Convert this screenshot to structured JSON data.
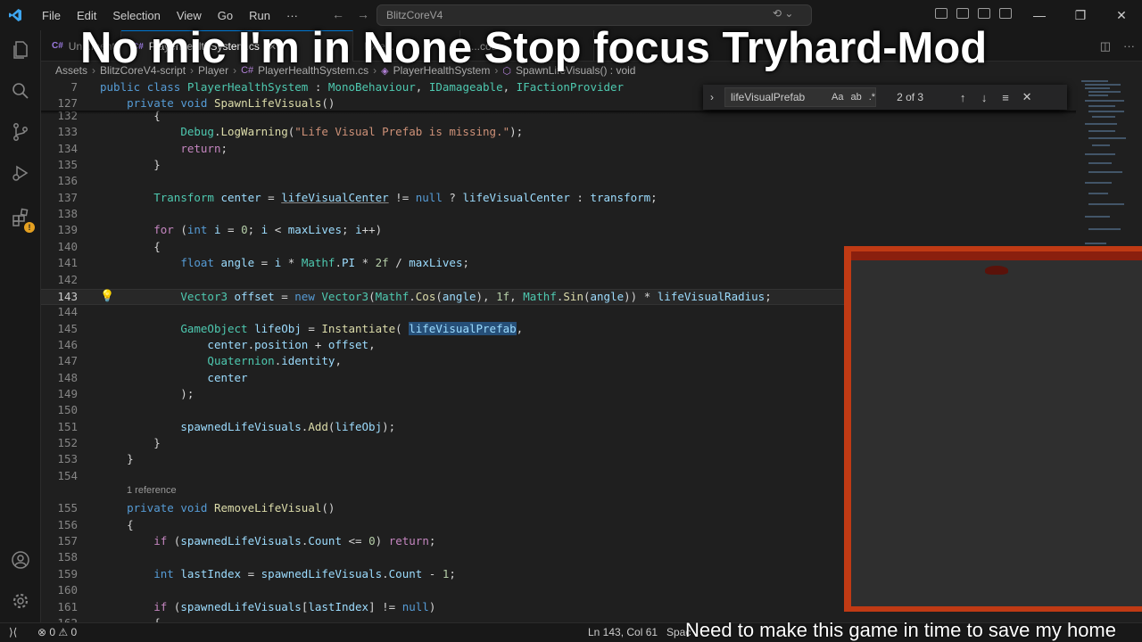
{
  "titlebar": {
    "menu": [
      "File",
      "Edit",
      "Selection",
      "View",
      "Go",
      "Run",
      "···"
    ],
    "command_center": "BlitzCoreV4"
  },
  "tabs": [
    {
      "label": "Un...ments.cs",
      "active": false
    },
    {
      "label": "PlayerHealthSystem.cs",
      "active": true
    },
    {
      "label": "Exte...",
      "active": false
    },
    {
      "label": "...code...",
      "active": false
    }
  ],
  "breadcrumb": [
    "Assets",
    "BlitzCoreV4-script",
    "Player",
    "PlayerHealthSystem.cs",
    "PlayerHealthSystem",
    "SpawnLifeVisuals() : void"
  ],
  "find": {
    "query": "lifeVisualPrefab",
    "match_case": "Aa",
    "whole_word": "ab",
    "regex": ".*",
    "count": "2 of 3"
  },
  "editor": {
    "sticky": [
      {
        "n": "7",
        "html": "<span class=\"k\">public</span> <span class=\"k\">class</span> <span class=\"t\">PlayerHealthSystem</span> : <span class=\"t\">MonoBehaviour</span>, <span class=\"t\">IDamageable</span>, <span class=\"t\">IFactionProvider</span>"
      },
      {
        "n": "127",
        "html": "    <span class=\"k\">private</span> <span class=\"k\">void</span> <span class=\"f\">SpawnLifeVisuals</span>()"
      }
    ],
    "lines": [
      {
        "n": "132",
        "html": "        {"
      },
      {
        "n": "133",
        "html": "            <span class=\"t\">Debug</span>.<span class=\"f\">LogWarning</span>(<span class=\"s\">\"Life Visual Prefab is missing.\"</span>);"
      },
      {
        "n": "134",
        "html": "            <span class=\"c\">return</span>;"
      },
      {
        "n": "135",
        "html": "        }"
      },
      {
        "n": "136",
        "html": ""
      },
      {
        "n": "137",
        "html": "        <span class=\"t\">Transform</span> <span class=\"v\">center</span> = <span class=\"v ul\">lifeVisualCenter</span> != <span class=\"k\">null</span> ? <span class=\"v\">lifeVisualCenter</span> : <span class=\"v\">transform</span>;"
      },
      {
        "n": "138",
        "html": ""
      },
      {
        "n": "139",
        "html": "        <span class=\"c\">for</span> (<span class=\"k\">int</span> <span class=\"v\">i</span> = <span class=\"n\">0</span>; <span class=\"v\">i</span> &lt; <span class=\"v\">maxLives</span>; <span class=\"v\">i</span>++)"
      },
      {
        "n": "140",
        "html": "        {"
      },
      {
        "n": "141",
        "html": "            <span class=\"k\">float</span> <span class=\"v\">angle</span> = <span class=\"v\">i</span> * <span class=\"t\">Mathf</span>.<span class=\"v\">PI</span> * <span class=\"n\">2f</span> / <span class=\"v\">maxLives</span>;"
      },
      {
        "n": "142",
        "html": ""
      },
      {
        "n": "143",
        "html": "            <span class=\"t\">Vector3</span> <span class=\"v\">offset</span> = <span class=\"k\">new</span> <span class=\"t\">Vector3</span>(<span class=\"t\">Mathf</span>.<span class=\"f\">Cos</span>(<span class=\"v\">angle</span>), <span class=\"n\">1f</span>, <span class=\"t\">Mathf</span>.<span class=\"f\">Sin</span>(<span class=\"v\">angle</span>)) * <span class=\"v\">lifeVisualRadius</span>;",
        "current": true
      },
      {
        "n": "144",
        "html": ""
      },
      {
        "n": "145",
        "html": "            <span class=\"t\">GameObject</span> <span class=\"v\">lifeObj</span> = <span class=\"f\">Instantiate</span>( <span class=\"v hl\">lifeVisualPrefab</span>,"
      },
      {
        "n": "146",
        "html": "                <span class=\"v\">center</span>.<span class=\"v\">position</span> + <span class=\"v\">offset</span>,"
      },
      {
        "n": "147",
        "html": "                <span class=\"t\">Quaternion</span>.<span class=\"v\">identity</span>,"
      },
      {
        "n": "148",
        "html": "                <span class=\"v\">center</span>"
      },
      {
        "n": "149",
        "html": "            );"
      },
      {
        "n": "150",
        "html": ""
      },
      {
        "n": "151",
        "html": "            <span class=\"v\">spawnedLifeVisuals</span>.<span class=\"f\">Add</span>(<span class=\"v\">lifeObj</span>);"
      },
      {
        "n": "152",
        "html": "        }"
      },
      {
        "n": "153",
        "html": "    }"
      },
      {
        "n": "154",
        "html": ""
      },
      {
        "lens": "1 reference"
      },
      {
        "n": "155",
        "html": "    <span class=\"k\">private</span> <span class=\"k\">void</span> <span class=\"f\">RemoveLifeVisual</span>()"
      },
      {
        "n": "156",
        "html": "    {"
      },
      {
        "n": "157",
        "html": "        <span class=\"c\">if</span> (<span class=\"v\">spawnedLifeVisuals</span>.<span class=\"v\">Count</span> &lt;= <span class=\"n\">0</span>) <span class=\"c\">return</span>;"
      },
      {
        "n": "158",
        "html": ""
      },
      {
        "n": "159",
        "html": "        <span class=\"k\">int</span> <span class=\"v\">lastIndex</span> = <span class=\"v\">spawnedLifeVisuals</span>.<span class=\"v\">Count</span> - <span class=\"n\">1</span>;"
      },
      {
        "n": "160",
        "html": ""
      },
      {
        "n": "161",
        "html": "        <span class=\"c\">if</span> (<span class=\"v\">spawnedLifeVisuals</span>[<span class=\"v\">lastIndex</span>] != <span class=\"k\">null</span>)"
      },
      {
        "n": "162",
        "html": "        {"
      }
    ]
  },
  "statusbar": {
    "problems": "⊗ 0 ⚠ 0",
    "position": "Ln 143, Col 61",
    "spaces": "Spac"
  },
  "overlay": {
    "title": "No mic I'm in None Stop focus Tryhard-Mod",
    "caption": "Need to make this game in time to save my home"
  },
  "colors": {
    "accent": "#0078d4",
    "editor_bg": "#1f1f1f",
    "chrome_bg": "#181818",
    "game_border": "#c03a14"
  }
}
